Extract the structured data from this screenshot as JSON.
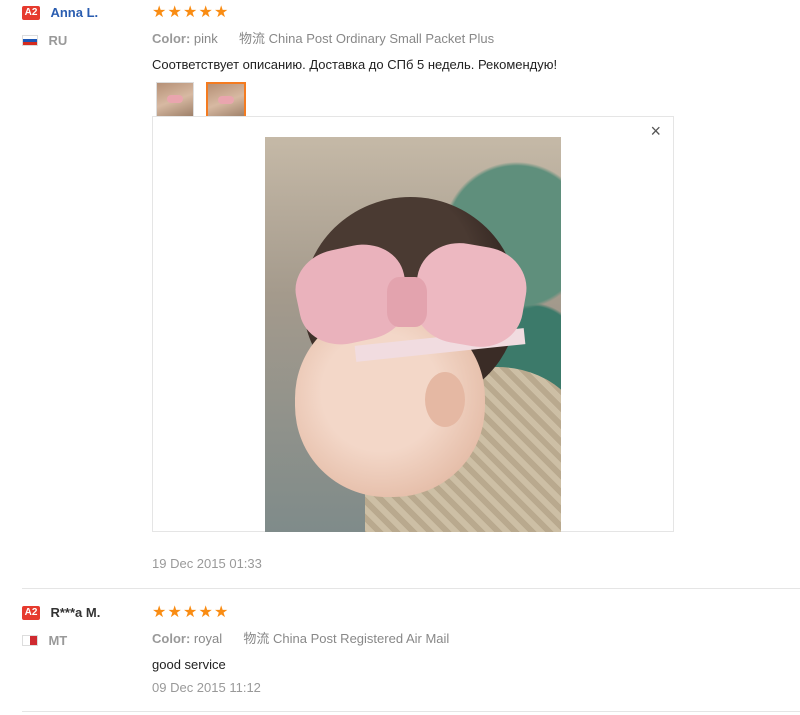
{
  "reviews": [
    {
      "badge": "A2",
      "name": "Anna L.",
      "country": "RU",
      "stars": 5,
      "color_label": "Color:",
      "color_value": "pink",
      "logistics_label": "物流",
      "logistics_value": "China Post Ordinary Small Packet Plus",
      "text": "Соответствует описанию. Доставка до СПб 5 недель. Рекомендую!",
      "date": "19 Dec 2015 01:33",
      "close_glyph": "×"
    },
    {
      "badge": "A2",
      "name": "R***a M.",
      "country": "MT",
      "stars": 5,
      "color_label": "Color:",
      "color_value": "royal",
      "logistics_label": "物流",
      "logistics_value": "China Post Registered Air Mail",
      "text": "good service",
      "date": "09 Dec 2015 11:12"
    }
  ],
  "colors": {
    "badge_bg": "#e63a2e",
    "name": "#333333",
    "star": "#f98c13",
    "active_thumb": "#f47b20"
  },
  "icons": {
    "star": "★",
    "flag_ru": "russia-flag-icon",
    "flag_mt": "malta-flag-icon"
  }
}
